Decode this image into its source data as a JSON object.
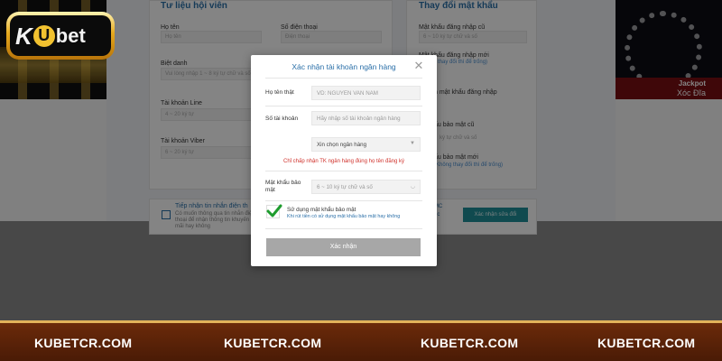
{
  "background": {
    "panel_left": {
      "title": "Tư liệu hội viên",
      "fields": [
        {
          "label": "Họ tên",
          "value": "Họ tên"
        },
        {
          "label": "Số điện thoại",
          "value": "Điện thoại"
        },
        {
          "label": "Biệt danh",
          "value": "Vui lòng nhập 1 ~ 8 ký tự chữ và số"
        },
        {
          "label": "Tài khoản Line",
          "value": "4 ~ 20 ký tự"
        },
        {
          "label": "Tài khoản Viber",
          "value": "6 ~ 20 ký tự"
        }
      ]
    },
    "panel_right": {
      "title": "Thay đổi mật khẩu",
      "items": [
        {
          "label": "Mật khẩu đăng nhập cũ",
          "value": "6 ~ 10 ký tự chữ và số",
          "note": ""
        },
        {
          "label": "Mật khẩu đăng nhập mới",
          "value": "",
          "note": "(Không thay đổi thì để trống)"
        },
        {
          "label": "n mật khẩu đăng nhập",
          "value": "",
          "note": ""
        },
        {
          "label": "ẩu bảo mật cũ",
          "value": "ký tự chữ và số",
          "note": ""
        },
        {
          "label": "ẩu bảo mật mới",
          "value": "",
          "note": "(Không thay đổi thì để trống)"
        }
      ]
    },
    "bottom_bar": {
      "checkbox_title": "Tiếp nhận tin nhắn điện th",
      "checkbox_sub": "Có muốn thông qua tin nhắn điện thoại để nhận thông tin khuyến mãi hay không",
      "mc_label": "MC",
      "mc_sub": "úc",
      "confirm_label": "Xác nhận sửa đổi"
    },
    "jackpot": {
      "line1": "Jackpot",
      "line2": "Xóc Đĩa"
    }
  },
  "logo": {
    "k": "K",
    "u": "U",
    "bet": "bet"
  },
  "modal": {
    "title": "Xác nhận tài khoản ngân hàng",
    "close_symbol": "✕",
    "fields": {
      "name_label": "Họ tên thật",
      "name_placeholder": "VD: NGUYEN VAN NAM",
      "account_label": "Số tài khoản",
      "account_placeholder": "Hãy nhập số tài khoản ngân hàng",
      "bank_select": "Xin chọn ngân hàng",
      "warning": "Chỉ chấp nhận TK ngân hàng đúng họ tên đăng ký",
      "security_label": "Mật khẩu bảo mật",
      "security_placeholder": "6 ~ 10 ký tự chữ và số"
    },
    "checkbox": {
      "title": "Sử dụng mật khẩu bảo mật",
      "subtitle": "Khi rút tiền có sử dụng mật khẩu bảo mật hay không",
      "checked": true
    },
    "submit_label": "Xác nhận"
  },
  "footer": {
    "items": [
      "KUBETCR.COM",
      "KUBETCR.COM",
      "KUBETCR.COM",
      "KUBETCR.COM"
    ]
  },
  "colors": {
    "accent_blue": "#2a6fa8",
    "warning_red": "#d0312b",
    "check_green": "#1e9c2e",
    "footer_brown": "#5a2208",
    "logo_gold": "#e6a91e"
  }
}
